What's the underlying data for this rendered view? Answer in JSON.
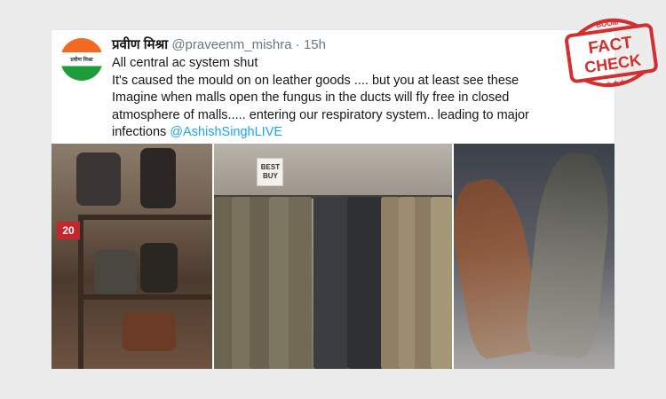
{
  "tweet": {
    "name": "प्रवीण मिश्रा",
    "handle": "@praveenm_mishra",
    "separator": "·",
    "time": "15h",
    "avatar_text": "प्रवीण मिश्रा",
    "lines": [
      "All central ac system shut",
      "It's caused the mould on on leather goods .... but you at least see these",
      "Imagine when malls open the fungus in the ducts will fly free in closed",
      "atmosphere of malls..... entering our respiratory system.. leading to major"
    ],
    "last_line_prefix": "infections ",
    "mention": "@AshishSinghLIVE"
  },
  "photos": {
    "bags": {
      "price_tag": "20"
    },
    "pants": {
      "sign_line1": "BEST",
      "sign_line2": "BUY"
    }
  },
  "stamp": {
    "top_text": "BOOM",
    "word1": "FACT",
    "word2": "CHECK",
    "stars": "★★★",
    "color": "#d32f2f"
  }
}
